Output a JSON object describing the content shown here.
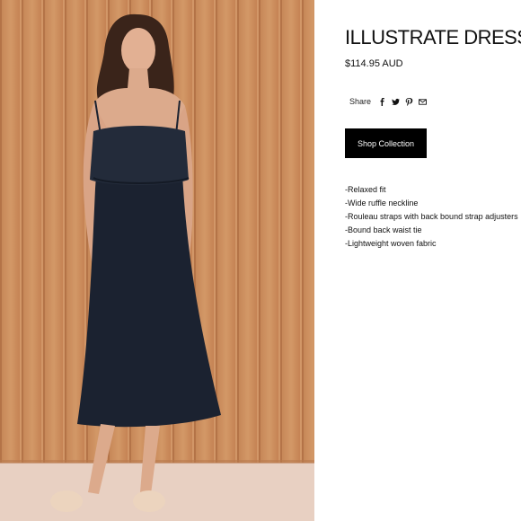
{
  "product": {
    "title": "ILLUSTRATE DRESS",
    "price": "$114.95 AUD"
  },
  "share": {
    "label": "Share",
    "icons": [
      "facebook-icon",
      "twitter-icon",
      "pinterest-icon",
      "email-icon"
    ]
  },
  "cta": {
    "label": "Shop Collection"
  },
  "features": [
    "-Relaxed fit",
    "-Wide ruffle neckline",
    "-Rouleau straps with back bound strap adjusters",
    "-Bound back waist tie",
    "-Lightweight woven fabric"
  ],
  "colors": {
    "button_bg": "#000000",
    "wood_panel": "#c98a5c",
    "dress": "#1b2230",
    "floor": "#e6cdbf"
  }
}
